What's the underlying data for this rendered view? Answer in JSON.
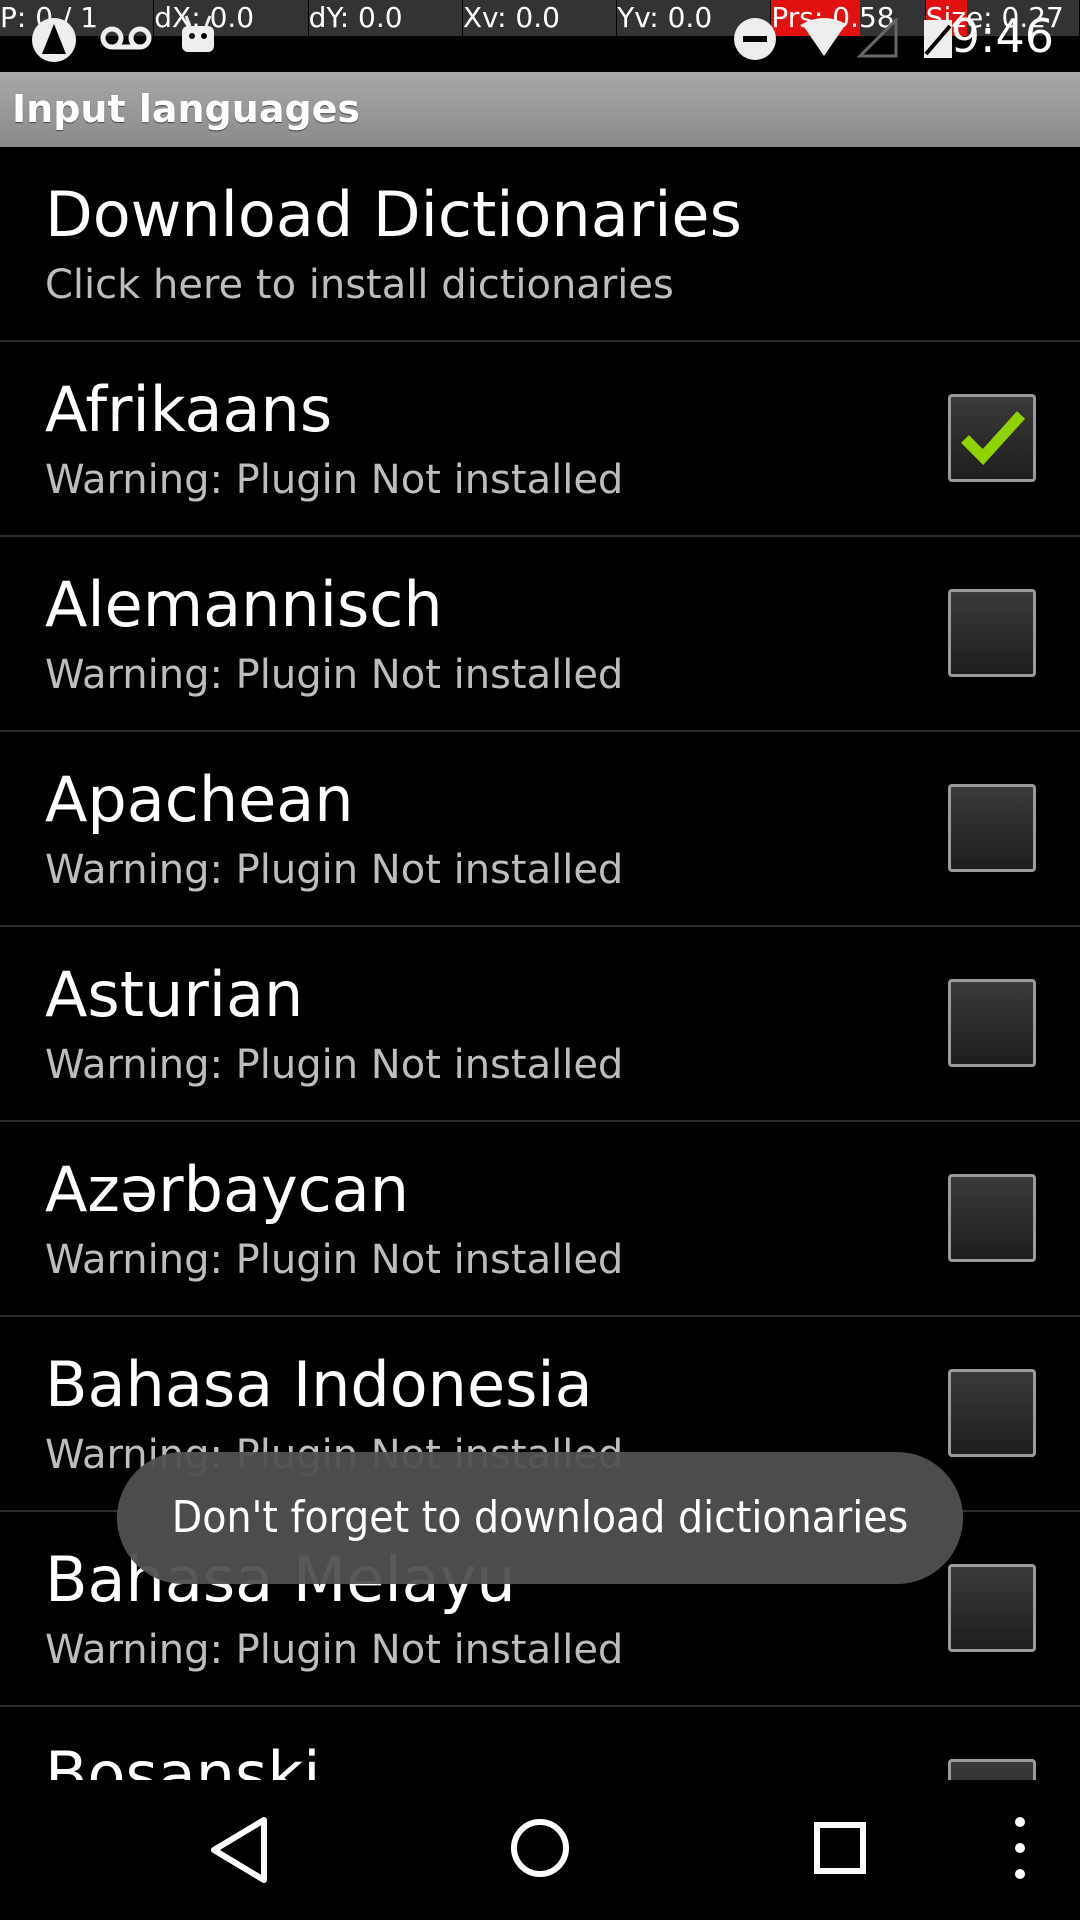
{
  "status_bar": {
    "debug": [
      {
        "text": "P: 0 / 1",
        "fill": 0
      },
      {
        "text": "dX: 0.0",
        "fill": 0
      },
      {
        "text": "dY: 0.0",
        "fill": 0
      },
      {
        "text": "Xv: 0.0",
        "fill": 0
      },
      {
        "text": "Yv: 0.0",
        "fill": 0
      },
      {
        "text": "Prs: 0.58",
        "fill": 0.58
      },
      {
        "text": "Size: 0.27",
        "fill": 0.27
      }
    ],
    "clock": "9:46",
    "icons": [
      "app-icon",
      "voicemail-icon",
      "android-icon",
      "do-not-disturb-icon",
      "wifi-icon",
      "signal-icon",
      "battery-icon"
    ]
  },
  "title_bar": {
    "title": "Input languages"
  },
  "download": {
    "title": "Download Dictionaries",
    "summary": "Click here to install dictionaries"
  },
  "languages": [
    {
      "name": "Afrikaans",
      "summary": "Warning: Plugin Not installed",
      "checked": true
    },
    {
      "name": "Alemannisch",
      "summary": "Warning: Plugin Not installed",
      "checked": false
    },
    {
      "name": "Apachean",
      "summary": "Warning: Plugin Not installed",
      "checked": false
    },
    {
      "name": "Asturian",
      "summary": "Warning: Plugin Not installed",
      "checked": false
    },
    {
      "name": "Azərbaycan",
      "summary": "Warning: Plugin Not installed",
      "checked": false
    },
    {
      "name": "Bahasa Indonesia",
      "summary": "Warning: Plugin Not installed",
      "checked": false
    },
    {
      "name": "Bahasa Melayu",
      "summary": "Warning: Plugin Not installed",
      "checked": false
    },
    {
      "name": "Bosanski",
      "summary": "",
      "checked": false
    }
  ],
  "toast": {
    "text": "Don't forget to download dictionaries"
  },
  "nav_bar": {
    "icons": [
      "back-icon",
      "home-icon",
      "recents-icon",
      "overflow-menu-icon"
    ]
  },
  "colors": {
    "title_bar": "#999999",
    "check": "#8fd400",
    "toast": "#505050",
    "debug_red": "#e11111"
  }
}
